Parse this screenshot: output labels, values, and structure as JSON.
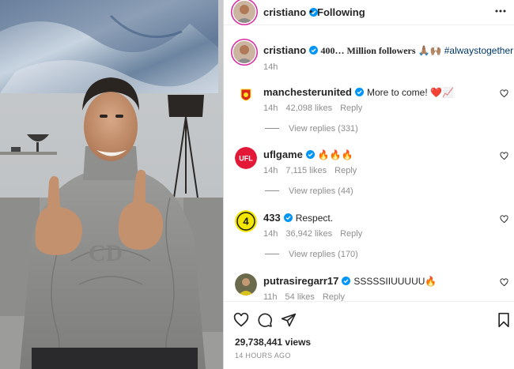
{
  "post": {
    "username": "cristiano",
    "separator": "•",
    "follow_state": "Following",
    "caption_body": "400… Million followers 🙏🏽🙌🏽",
    "caption_hashtag": "#alwaystogether",
    "caption_time": "14h",
    "views": "29,738,441 views",
    "posted_ago": "14 HOURS AGO"
  },
  "comments": [
    {
      "username": "manchesterunited",
      "text": "More to come! ❤️📈",
      "time": "14h",
      "likes": "42,098 likes",
      "reply_label": "Reply",
      "replies": "View replies (331)"
    },
    {
      "username": "uflgame",
      "text": "🔥🔥🔥",
      "time": "14h",
      "likes": "7,115 likes",
      "reply_label": "Reply",
      "replies": "View replies (44)"
    },
    {
      "username": "433",
      "text": "Respect.",
      "time": "14h",
      "likes": "36,942 likes",
      "reply_label": "Reply",
      "replies": "View replies (170)"
    },
    {
      "username": "putrasiregarr17",
      "text": "SSSSSIIUUUUU🔥",
      "time": "11h",
      "likes": "54 likes",
      "reply_label": "Reply"
    }
  ],
  "avatar_text": {
    "ufl": "UFL",
    "four33": "4"
  },
  "colors": {
    "verified": "#0095f6",
    "link": "#00376b",
    "muted": "#8e8e8e",
    "text": "#262626",
    "manu_red": "#da291c",
    "ufl_red": "#e31837",
    "four33_yellow": "#f3e600"
  },
  "icons": [
    "more-icon",
    "heart-icon",
    "comment-icon",
    "share-icon",
    "bookmark-icon",
    "verified-badge-icon"
  ]
}
